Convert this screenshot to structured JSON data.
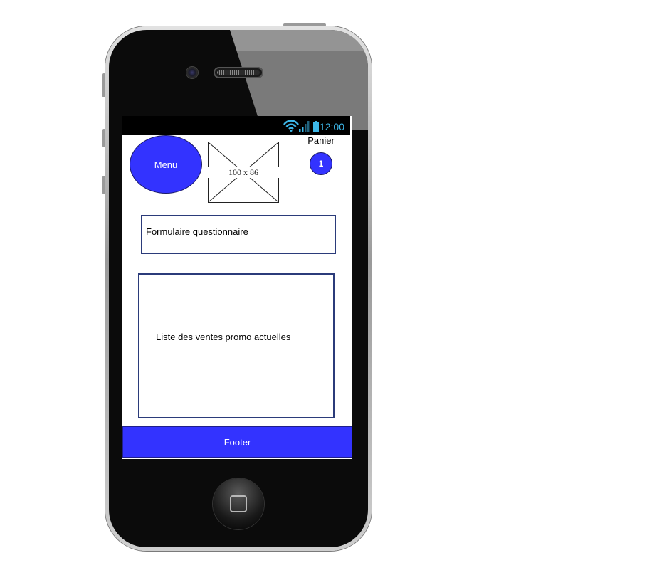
{
  "status_bar": {
    "time": "12:00",
    "icons": [
      "wifi-icon",
      "signal-icon",
      "battery-icon"
    ],
    "time_color": "#3db7e8"
  },
  "header": {
    "menu_label": "Menu",
    "image_placeholder_label": "100 x 86",
    "cart_label": "Panier",
    "cart_count": "1"
  },
  "main": {
    "form_label": "Formulaire questionnaire",
    "promo_list_label": "Liste des ventes promo actuelles"
  },
  "footer": {
    "label": "Footer"
  },
  "colors": {
    "accent": "#3333ff",
    "border": "#2b3b7a"
  }
}
